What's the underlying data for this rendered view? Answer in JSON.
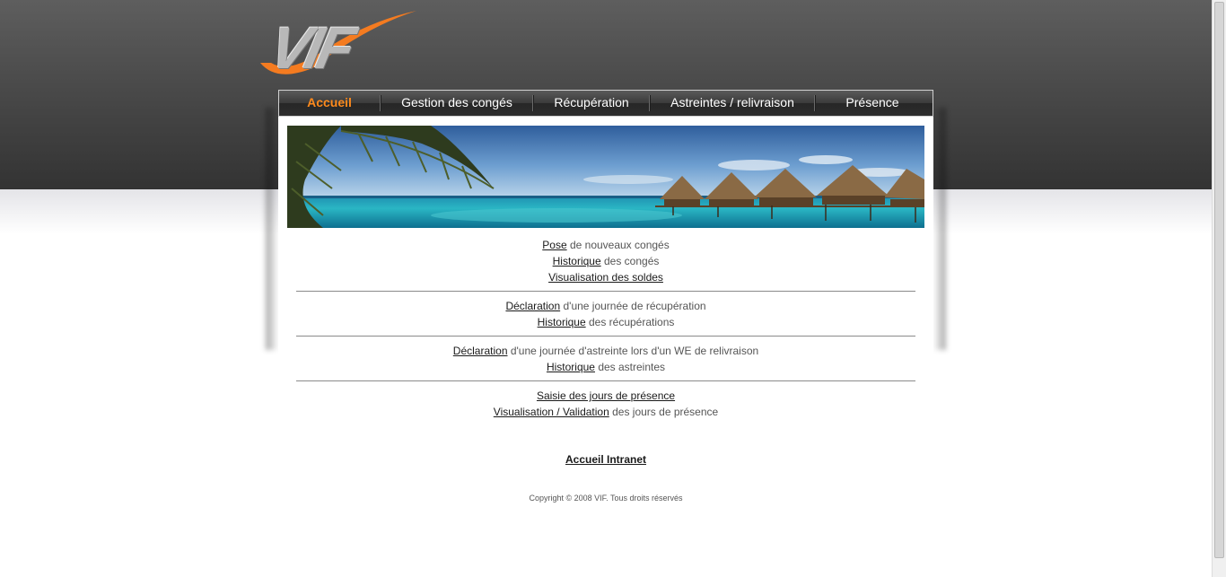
{
  "logo": {
    "text": "VIF",
    "swoosh_color": "#f47b20"
  },
  "nav": {
    "items": [
      {
        "label": "Accueil",
        "active": true
      },
      {
        "label": "Gestion des congés",
        "active": false
      },
      {
        "label": "Récupération",
        "active": false
      },
      {
        "label": "Astreintes / relivraison",
        "active": false
      },
      {
        "label": "Présence",
        "active": false
      }
    ],
    "active_color": "#ff8a1c"
  },
  "sections": {
    "conges": {
      "pose_link": "Pose",
      "pose_text": " de nouveaux congés",
      "historique_link": "Historique",
      "historique_text": " des congés",
      "soldes_link": "Visualisation des soldes"
    },
    "recuperation": {
      "declaration_link": "Déclaration",
      "declaration_text": " d'une journée de récupération",
      "historique_link": "Historique",
      "historique_text": " des récupérations"
    },
    "astreintes": {
      "declaration_link": "Déclaration",
      "declaration_text": " d'une journée d'astreinte lors d'un WE de relivraison",
      "historique_link": "Historique",
      "historique_text": " des astreintes"
    },
    "presence": {
      "saisie_link": "Saisie des jours de présence",
      "visualisation_link": "Visualisation / Validation",
      "visualisation_text": " des jours de présence"
    }
  },
  "footer": {
    "intranet_link": "Accueil Intranet",
    "copyright": "Copyright © 2008 VIF. Tous droits réservés"
  }
}
